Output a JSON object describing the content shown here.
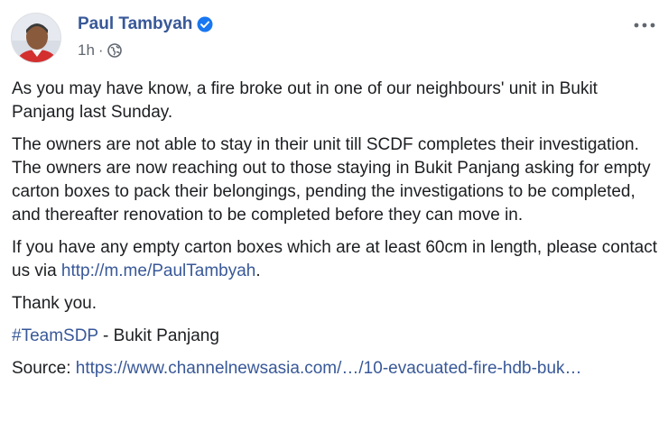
{
  "author": {
    "name": "Paul Tambyah",
    "timestamp": "1h",
    "separator": "·",
    "verified_icon": "verified-check-icon",
    "privacy_icon": "globe-icon"
  },
  "post": {
    "paragraph1": "As you may have know, a fire broke out in one of our neighbours' unit in Bukit Panjang last Sunday.",
    "paragraph2": "The owners are not able to stay in their unit till SCDF completes their investigation. The owners are now reaching out to those staying in Bukit Panjang asking for empty carton boxes to pack their belongings, pending the investigations to be completed, and thereafter renovation to be completed before they can move in.",
    "paragraph3_text": "If you have any empty carton boxes which are at least 60cm in length, please contact us via ",
    "paragraph3_link": "http://m.me/PaulTambyah",
    "paragraph3_end": ".",
    "thanks": "Thank you.",
    "hashtag": "#TeamSDP",
    "hashtag_suffix": " - Bukit Panjang",
    "source_label": "Source: ",
    "source_link": "https://www.channelnewsasia.com/…/10-evacuated-fire-hdb-buk…"
  },
  "colors": {
    "link": "#385898",
    "text": "#1c1e21",
    "meta": "#606770",
    "verified": "#1877f2"
  }
}
